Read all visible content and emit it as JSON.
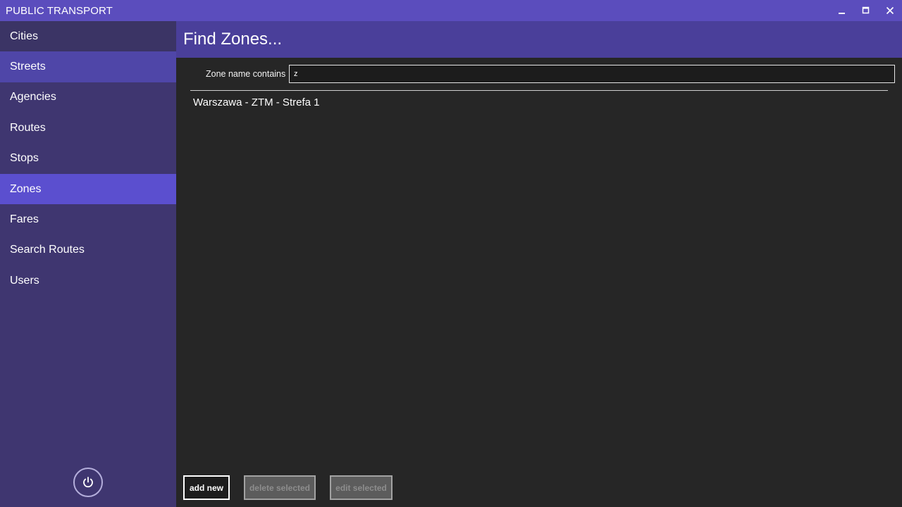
{
  "app": {
    "title": "PUBLIC TRANSPORT"
  },
  "window_controls": {
    "minimize_icon": "minimize-icon",
    "maximize_icon": "maximize-icon",
    "close_icon": "close-icon"
  },
  "sidebar": {
    "items": [
      {
        "label": "Cities"
      },
      {
        "label": "Streets"
      },
      {
        "label": "Agencies"
      },
      {
        "label": "Routes"
      },
      {
        "label": "Stops"
      },
      {
        "label": "Zones"
      },
      {
        "label": "Fares"
      },
      {
        "label": "Search Routes"
      },
      {
        "label": "Users"
      }
    ],
    "selected": "Zones",
    "power_icon": "power-icon"
  },
  "main": {
    "title": "Find Zones...",
    "search": {
      "label": "Zone name contains",
      "value": "z"
    },
    "results": [
      "Warszawa - ZTM - Strefa 1"
    ]
  },
  "footer": {
    "add_label": "add new",
    "delete_label": "delete selected",
    "edit_label": "edit selected"
  },
  "colors": {
    "titlebar": "#5b4dbd",
    "sidebar": "#3f3670",
    "selected": "#5b4fcf",
    "header": "#4a3f9a",
    "content": "#262626"
  }
}
